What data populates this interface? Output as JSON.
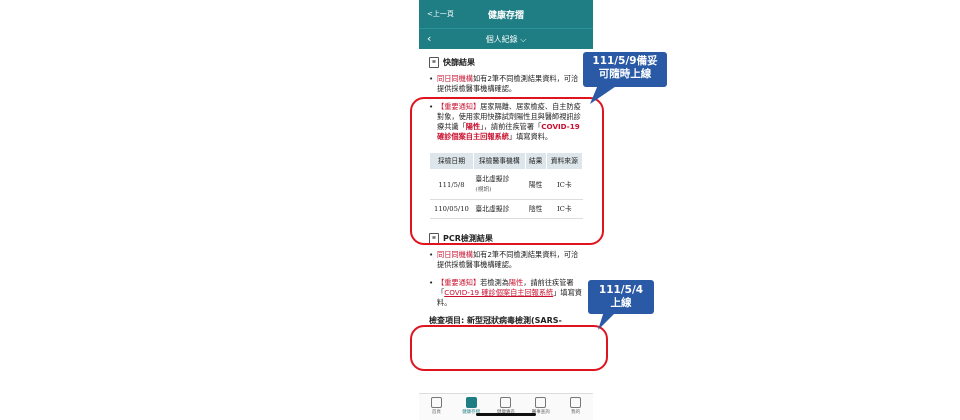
{
  "header": {
    "back_label": "<上一頁",
    "title": "健康存摺"
  },
  "subheader": {
    "title": "個人紀錄 ⌵"
  },
  "rapid": {
    "title": "快篩結果",
    "note1_red": "同日同機構",
    "note1_rest": "如有2筆不同檢測結果資料，可洽提供採檢醫事機構確認。",
    "notice_tag": "【重要通知】",
    "notice_text": "居家隔離、居家檢疫、自主防疫對象，使用家用快篩試劑陽性且與醫師視訊診療共識「",
    "notice_pos": "陽性",
    "notice_mid": "」，請前往疾管署「",
    "notice_link": "COVID-19 確診個案自主回報系統",
    "notice_end": "」填寫資料。",
    "headers": [
      "採檢日期",
      "採檢醫事機構",
      "結果",
      "資料來源"
    ],
    "rows": [
      {
        "date": "111/5/8",
        "inst": "臺北虛擬診",
        "inst_sub": "(視訊)",
        "result": "陽性",
        "source": "IC卡"
      },
      {
        "date": "110/05/10",
        "inst": "臺北虛擬診",
        "inst_sub": "",
        "result": "陰性",
        "source": "IC卡"
      }
    ]
  },
  "pcr": {
    "title": "PCR檢測結果",
    "note1_red": "同日同機構",
    "note1_rest": "如有2筆不同檢測結果資料，可洽提供採檢醫事機構確認。",
    "notice_tag": "【重要通知】",
    "notice_text": "若檢測為",
    "notice_pos": "陽性",
    "notice_mid": "，請前往疾管署「",
    "notice_link": "COVID-19 確診個案自主回報系統",
    "notice_end": "」填寫資料。",
    "cut_text": "檢查項目: 新型冠狀病毒檢測(SARS-"
  },
  "nav": [
    "首頁",
    "健康存摺",
    "健康專區",
    "醫事查詢",
    "我的"
  ],
  "callouts": {
    "top": "111/5/9備妥\n可隨時上線",
    "bottom": "111/5/4\n上線"
  },
  "colors": {
    "teal": "#1f7e84",
    "red": "#c8102e",
    "callout": "#2a5aa6"
  }
}
